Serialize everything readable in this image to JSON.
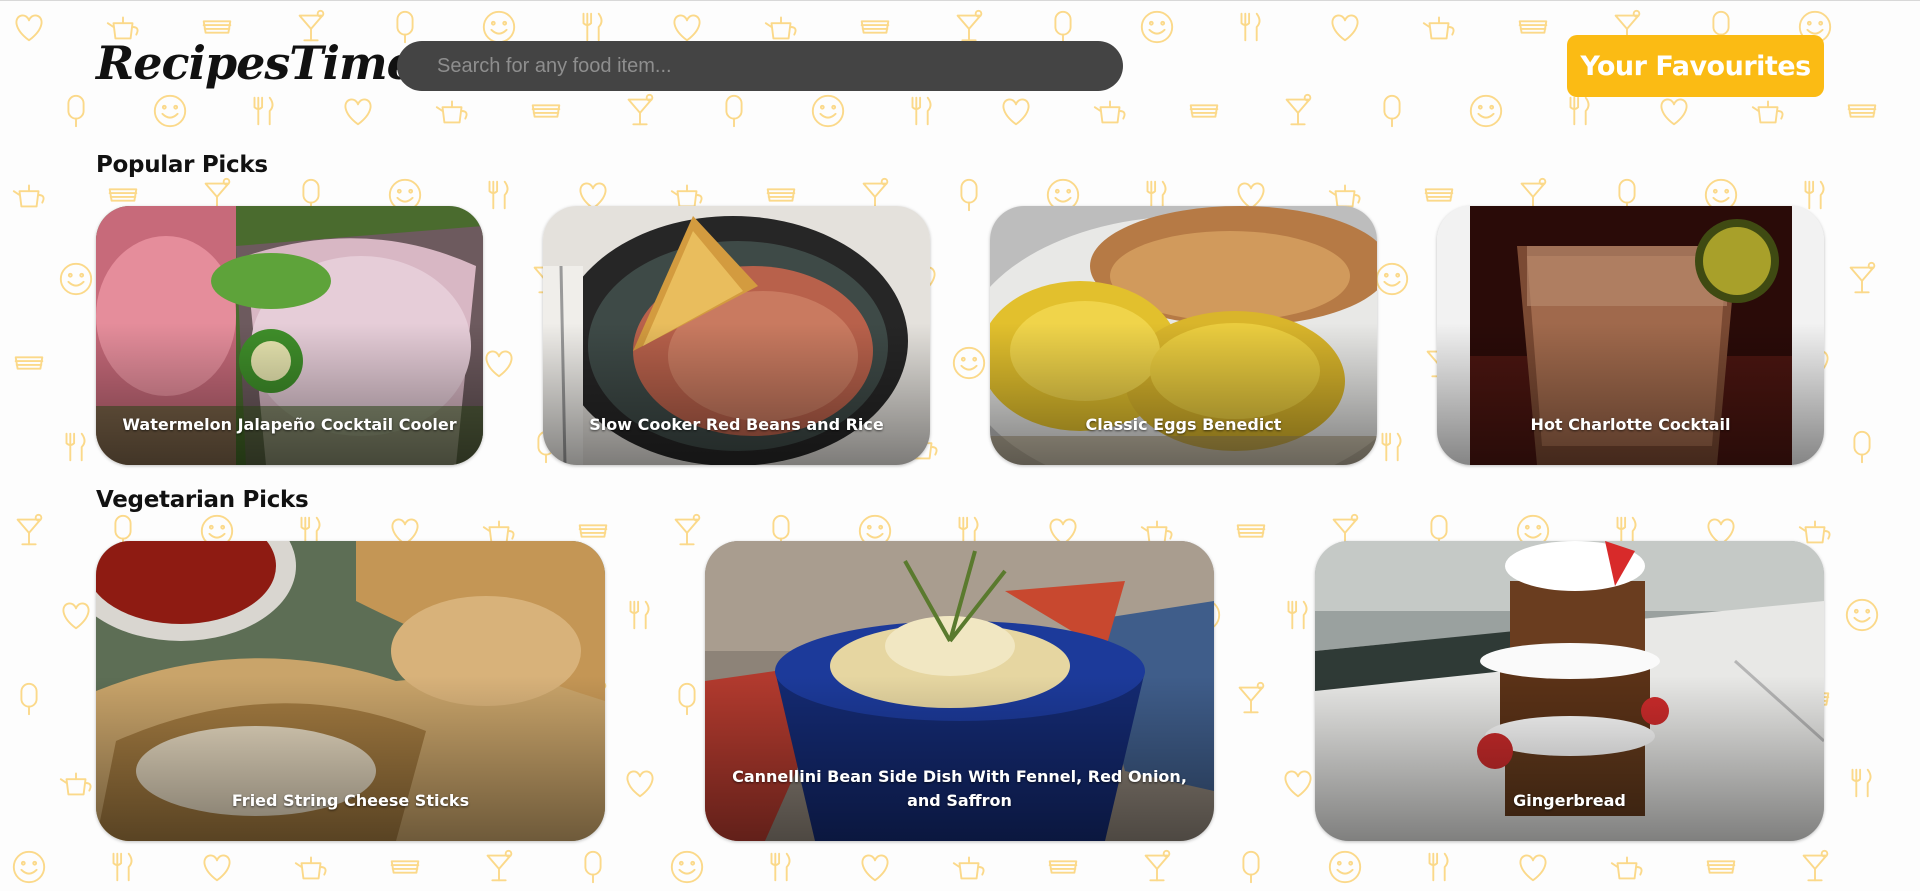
{
  "header": {
    "logo": "RecipesTime",
    "search_placeholder": "Search for any food item...",
    "favourites_label": "Your Favourites"
  },
  "popular": {
    "title": "Popular Picks",
    "items": [
      {
        "name": "Watermelon Jalapeño Cocktail Cooler"
      },
      {
        "name": "Slow Cooker Red Beans and Rice"
      },
      {
        "name": "Classic Eggs Benedict"
      },
      {
        "name": "Hot Charlotte Cocktail"
      }
    ]
  },
  "vegetarian": {
    "title": "Vegetarian Picks",
    "items": [
      {
        "name": "Fried String Cheese Sticks"
      },
      {
        "name": "Cannellini Bean Side Dish With Fennel, Red Onion, and Saffron"
      },
      {
        "name": "Gingerbread"
      }
    ]
  },
  "colors": {
    "accent": "#fbbb14",
    "search_bg": "#444444",
    "pattern": "#fbd98a"
  },
  "pattern_icons": [
    "heart-icon",
    "smiley-icon",
    "cocktail-icon",
    "teapot-icon",
    "cutlery-icon",
    "popsicle-icon",
    "sandwich-icon"
  ]
}
